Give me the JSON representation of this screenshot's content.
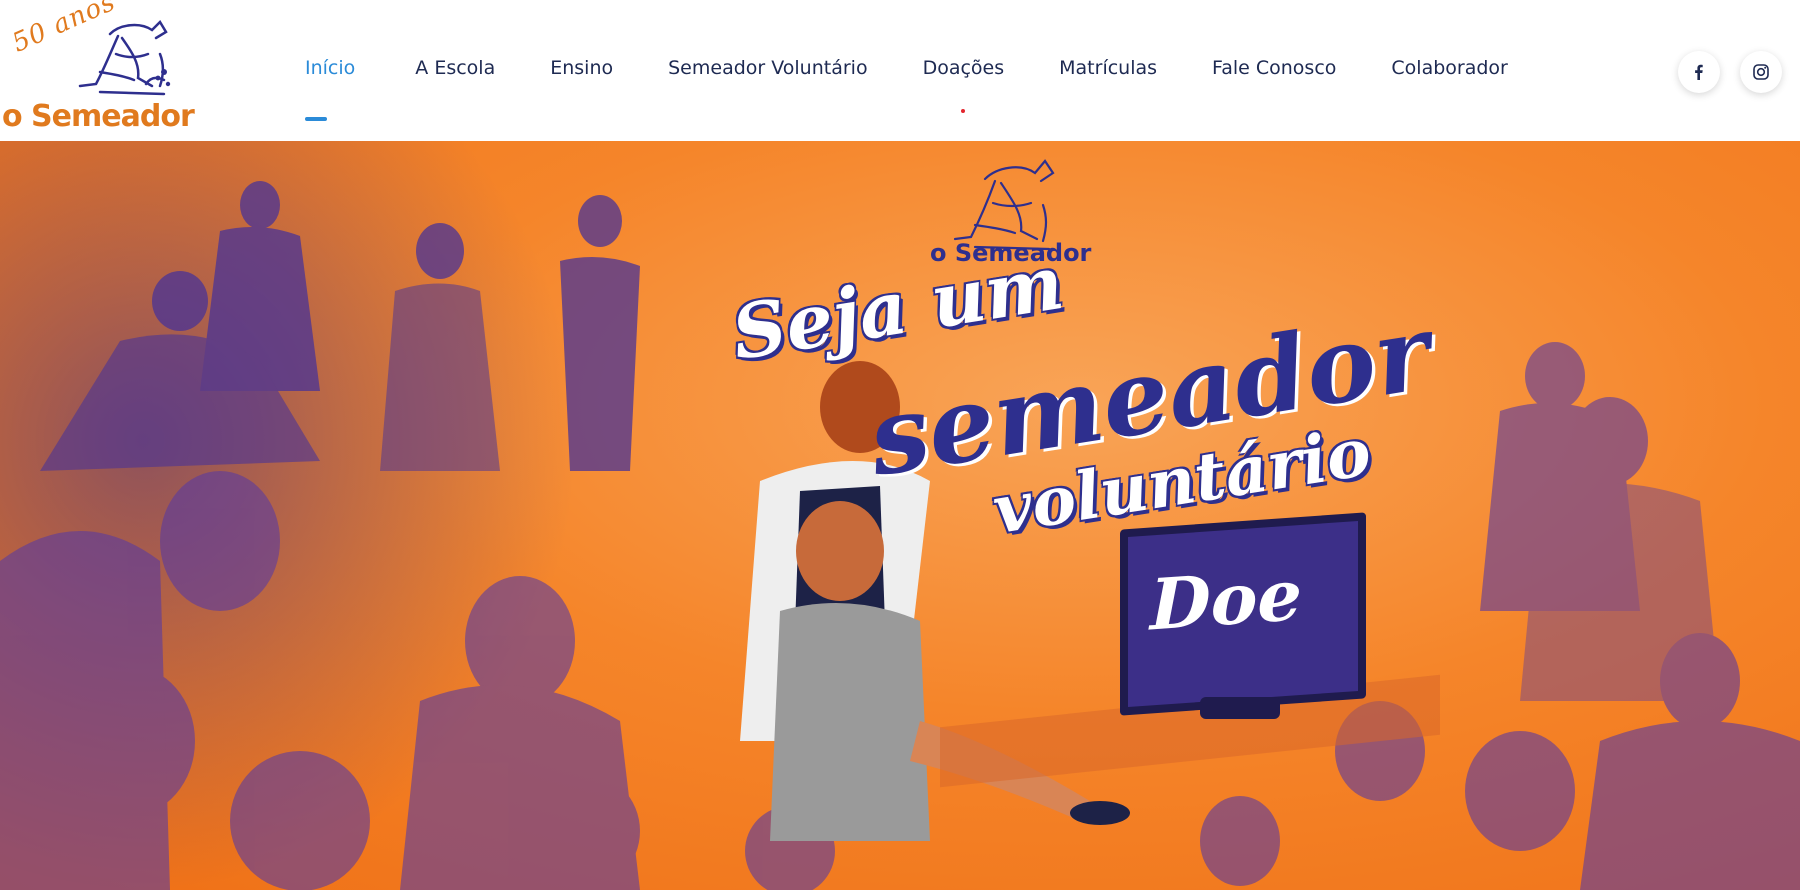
{
  "brand": {
    "anniversary": "50 anos",
    "name": "o Semeador",
    "logo_icon": "sower-figure-icon"
  },
  "nav": {
    "items": [
      {
        "label": "Início",
        "active": true
      },
      {
        "label": "A Escola"
      },
      {
        "label": "Ensino"
      },
      {
        "label": "Semeador Voluntário"
      },
      {
        "label": "Doações"
      },
      {
        "label": "Matrículas"
      },
      {
        "label": "Fale Conosco"
      },
      {
        "label": "Colaborador"
      }
    ]
  },
  "social": {
    "facebook_icon": "facebook-icon",
    "instagram_icon": "instagram-icon"
  },
  "hero": {
    "logo_name": "o Semeador",
    "headline": {
      "line1": "Seja um",
      "line2": "semeador",
      "line3": "voluntário"
    },
    "cta_screen_text": "Doe"
  },
  "colors": {
    "accent": "#2b8bd8",
    "nav_text": "#1e2a52",
    "brand_orange": "#e07a1e",
    "hero_orange": "#f5852a",
    "brand_purple": "#2e2f8e",
    "indicator_red": "#e3262e"
  }
}
